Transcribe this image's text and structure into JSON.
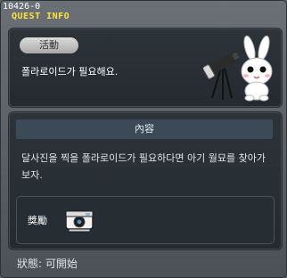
{
  "window": {
    "id_label": "10426-0",
    "title": "QUEST INFO"
  },
  "activity": {
    "badge": "活動",
    "text": "폴라로이드가 필요해요.",
    "mascot": "rabbit-with-telescope"
  },
  "content": {
    "header": "內容",
    "description": "달사진을 찍을 폴라로이드가 필요하다면 아기 월묘를 찾아가 보자."
  },
  "reward": {
    "label": "獎勵",
    "item_icon": "polaroid-camera-icon"
  },
  "status": {
    "text": "狀態:  可開始"
  }
}
